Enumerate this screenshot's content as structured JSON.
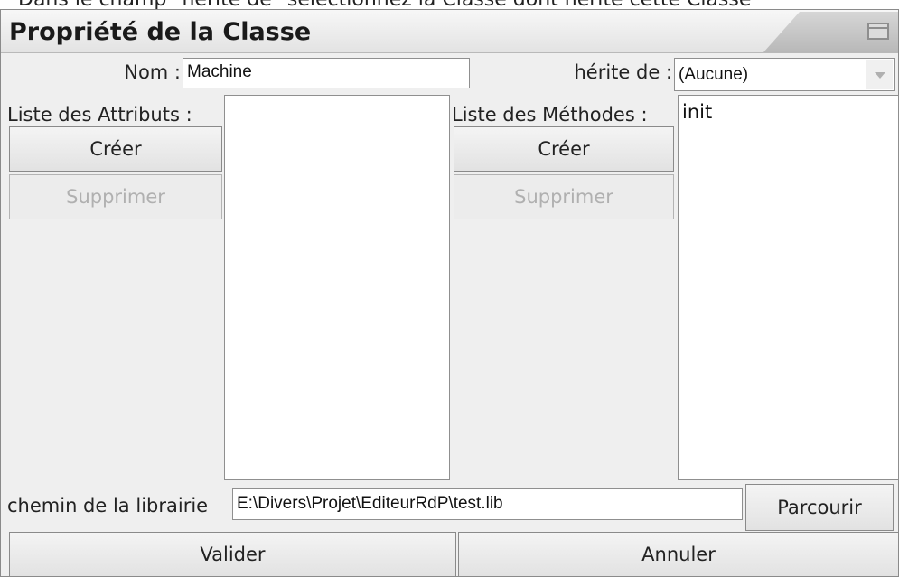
{
  "doc_text": "Dans le champ \"hérite de\" sélectionnez la Classe dont hérite cette Classe",
  "window": {
    "title": "Propriété de la Classe"
  },
  "form": {
    "nom_label": "Nom :",
    "nom_value": "Machine",
    "herite_label": "hérite de :",
    "herite_value": "(Aucune)",
    "attributs_label": "Liste des Attributs :",
    "methodes_label": "Liste des Méthodes :",
    "methodes_items": [
      "init"
    ],
    "chemin_label": "chemin de la librairie",
    "chemin_value": "E:\\Divers\\Projet\\EditeurRdP\\test.lib"
  },
  "buttons": {
    "creer_attr": "Créer",
    "supprimer_attr": "Supprimer",
    "creer_meth": "Créer",
    "supprimer_meth": "Supprimer",
    "parcourir": "Parcourir",
    "valider": "Valider",
    "annuler": "Annuler"
  },
  "icons": {
    "window_control": "maximize-icon",
    "dropdown": "chevron-down-icon"
  },
  "colors": {
    "window_bg": "#efefef",
    "disabled_text": "#b0b0b0"
  }
}
